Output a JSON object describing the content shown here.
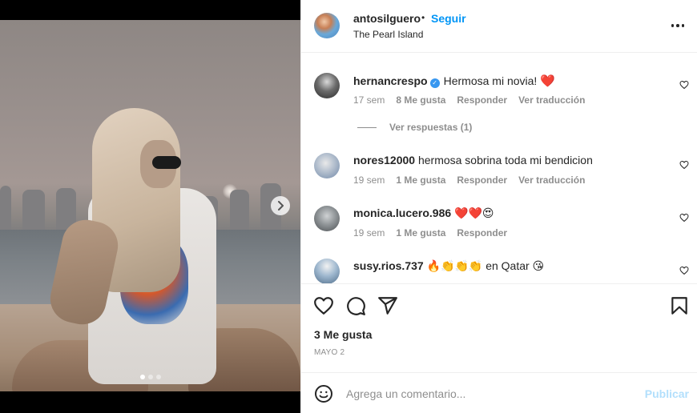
{
  "header": {
    "username": "antosilguero",
    "separator": "•",
    "follow_label": "Seguir",
    "location": "The Pearl Island",
    "more_icon": "more-horizontal-icon"
  },
  "media": {
    "next_icon": "chevron-right-icon",
    "carousel_total": 3,
    "carousel_active": 1
  },
  "comments": [
    {
      "username": "hernancrespo",
      "verified": true,
      "text": "Hermosa mi novia!",
      "emoji": "❤️",
      "time": "17 sem",
      "likes": "8 Me gusta",
      "reply_label": "Responder",
      "translate_label": "Ver traducción"
    },
    {
      "username": "nores12000",
      "text": "hermosa sobrina toda mi bendicion",
      "time": "19 sem",
      "likes": "1 Me gusta",
      "reply_label": "Responder",
      "translate_label": "Ver traducción"
    },
    {
      "username": "monica.lucero.986",
      "text": "❤️❤️😍",
      "time": "19 sem",
      "likes": "1 Me gusta",
      "reply_label": "Responder"
    },
    {
      "username": "susy.rios.737",
      "text": "🔥👏👏👏 en Qatar 😘"
    }
  ],
  "replies_label": "Ver respuestas (1)",
  "actions": {
    "like_icon": "heart-icon",
    "comment_icon": "comment-icon",
    "share_icon": "share-icon",
    "save_icon": "bookmark-icon",
    "likes_count": "3 Me gusta",
    "date": "MAYO 2"
  },
  "composer": {
    "emoji_icon": "emoji-icon",
    "placeholder": "Agrega un comentario...",
    "publish_label": "Publicar"
  },
  "colors": {
    "accent": "#0095f6",
    "publish_disabled": "#b2dffc",
    "text_secondary": "#8e8e8e",
    "heart": "#e0245e",
    "verified": "#3897f0"
  }
}
